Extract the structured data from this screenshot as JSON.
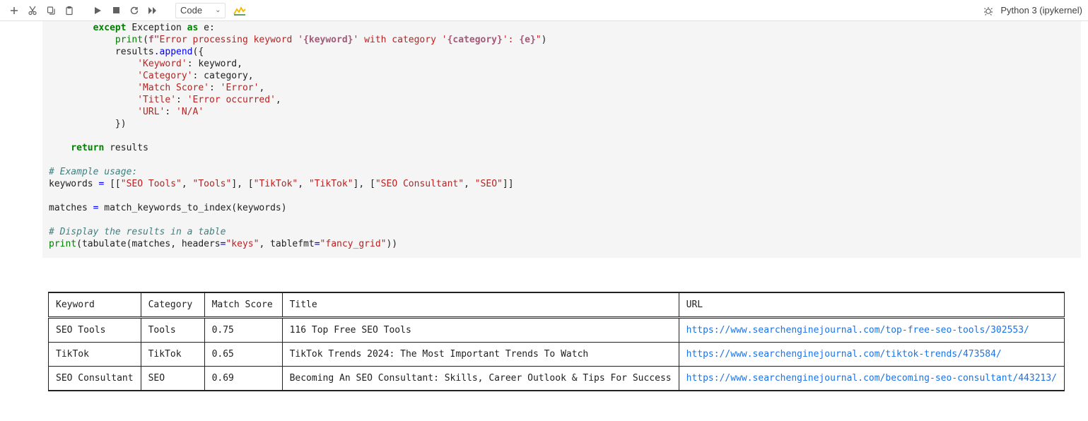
{
  "toolbar": {
    "cell_type": "Code",
    "kernel": "Python 3 (ipykernel)"
  },
  "code": {
    "line01a": "        except",
    "line01b": " Exception ",
    "line01c": "as",
    "line01d": " e:",
    "line02a": "            print",
    "line02b": "(",
    "line02c": "f\"",
    "line02d": "Error processing keyword '",
    "line02e": "{keyword}",
    "line02f": "' with category '",
    "line02g": "{category}",
    "line02h": "': ",
    "line02i": "{e}",
    "line02j": "\"",
    "line02k": ")",
    "line03a": "            results",
    "line03b": ".append",
    "line03c": "({",
    "line04a": "                ",
    "line04b": "'Keyword'",
    "line04c": ": keyword,",
    "line05a": "                ",
    "line05b": "'Category'",
    "line05c": ": category,",
    "line06a": "                ",
    "line06b": "'Match Score'",
    "line06c": ": ",
    "line06d": "'Error'",
    "line06e": ",",
    "line07a": "                ",
    "line07b": "'Title'",
    "line07c": ": ",
    "line07d": "'Error occurred'",
    "line07e": ",",
    "line08a": "                ",
    "line08b": "'URL'",
    "line08c": ": ",
    "line08d": "'N/A'",
    "line09": "            })",
    "line10": "",
    "line11a": "    return",
    "line11b": " results",
    "line12": "",
    "line13": "# Example usage:",
    "line14a": "keywords ",
    "line14b": "=",
    "line14c": " [[",
    "line14d": "\"SEO Tools\"",
    "line14e": ", ",
    "line14f": "\"Tools\"",
    "line14g": "], [",
    "line14h": "\"TikTok\"",
    "line14i": ", ",
    "line14j": "\"TikTok\"",
    "line14k": "], [",
    "line14l": "\"SEO Consultant\"",
    "line14m": ", ",
    "line14n": "\"SEO\"",
    "line14o": "]]",
    "line15": "",
    "line16a": "matches ",
    "line16b": "=",
    "line16c": " match_keywords_to_index(keywords)",
    "line17": "",
    "line18": "# Display the results in a table",
    "line19a": "print",
    "line19b": "(tabulate(matches, headers",
    "line19c": "=",
    "line19d": "\"keys\"",
    "line19e": ", tablefmt",
    "line19f": "=",
    "line19g": "\"fancy_grid\"",
    "line19h": "))"
  },
  "output": {
    "headers": {
      "c0": "Keyword",
      "c1": "Category",
      "c2": "Match Score",
      "c3": "Title",
      "c4": "URL"
    },
    "rows": [
      {
        "c0": "SEO Tools",
        "c1": "Tools",
        "c2": "0.75",
        "c3": "116 Top Free SEO Tools",
        "c4": "https://www.searchenginejournal.com/top-free-seo-tools/302553/"
      },
      {
        "c0": "TikTok",
        "c1": "TikTok",
        "c2": "0.65",
        "c3": "TikTok Trends 2024: The Most Important Trends To Watch",
        "c4": "https://www.searchenginejournal.com/tiktok-trends/473584/"
      },
      {
        "c0": "SEO Consultant",
        "c1": "SEO",
        "c2": "0.69",
        "c3": "Becoming An SEO Consultant: Skills, Career Outlook & Tips For Success",
        "c4": "https://www.searchenginejournal.com/becoming-seo-consultant/443213/"
      }
    ]
  }
}
